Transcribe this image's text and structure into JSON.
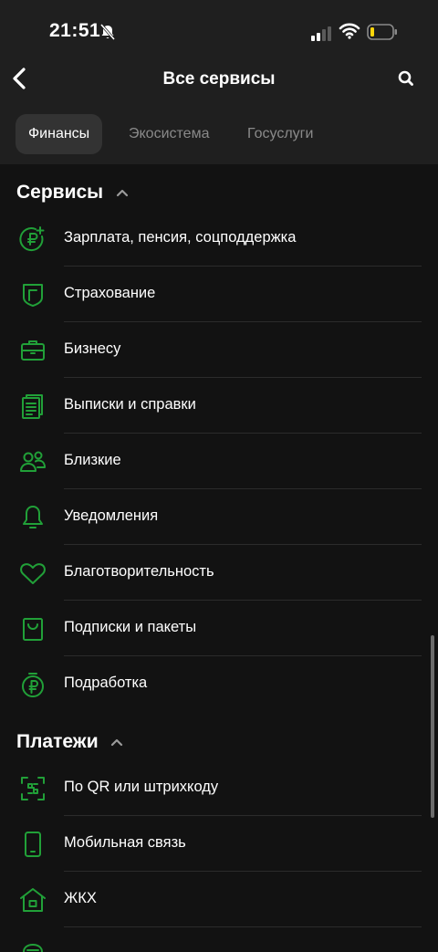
{
  "status": {
    "time": "21:51"
  },
  "nav": {
    "title": "Все сервисы"
  },
  "tabs": [
    {
      "label": "Финансы",
      "active": true
    },
    {
      "label": "Экосистема",
      "active": false
    },
    {
      "label": "Госуслуги",
      "active": false
    }
  ],
  "sections": {
    "services": {
      "title": "Сервисы",
      "items": [
        {
          "label": "Зарплата, пенсия, соцподдержка",
          "icon": "ruble-plus-icon"
        },
        {
          "label": "Страхование",
          "icon": "shield-icon"
        },
        {
          "label": "Бизнесу",
          "icon": "briefcase-icon"
        },
        {
          "label": "Выписки и справки",
          "icon": "documents-icon"
        },
        {
          "label": "Близкие",
          "icon": "people-icon"
        },
        {
          "label": "Уведомления",
          "icon": "bell-icon"
        },
        {
          "label": "Благотворительность",
          "icon": "heart-icon"
        },
        {
          "label": "Подписки и пакеты",
          "icon": "bag-icon"
        },
        {
          "label": "Подработка",
          "icon": "coin-icon"
        }
      ]
    },
    "payments": {
      "title": "Платежи",
      "items": [
        {
          "label": "По QR или штрихкоду",
          "icon": "qr-icon"
        },
        {
          "label": "Мобильная связь",
          "icon": "phone-icon"
        },
        {
          "label": "ЖКХ",
          "icon": "home-icon"
        }
      ]
    }
  },
  "colors": {
    "accent": "#21a038",
    "background": "#121212",
    "header": "#1f1f1f"
  }
}
